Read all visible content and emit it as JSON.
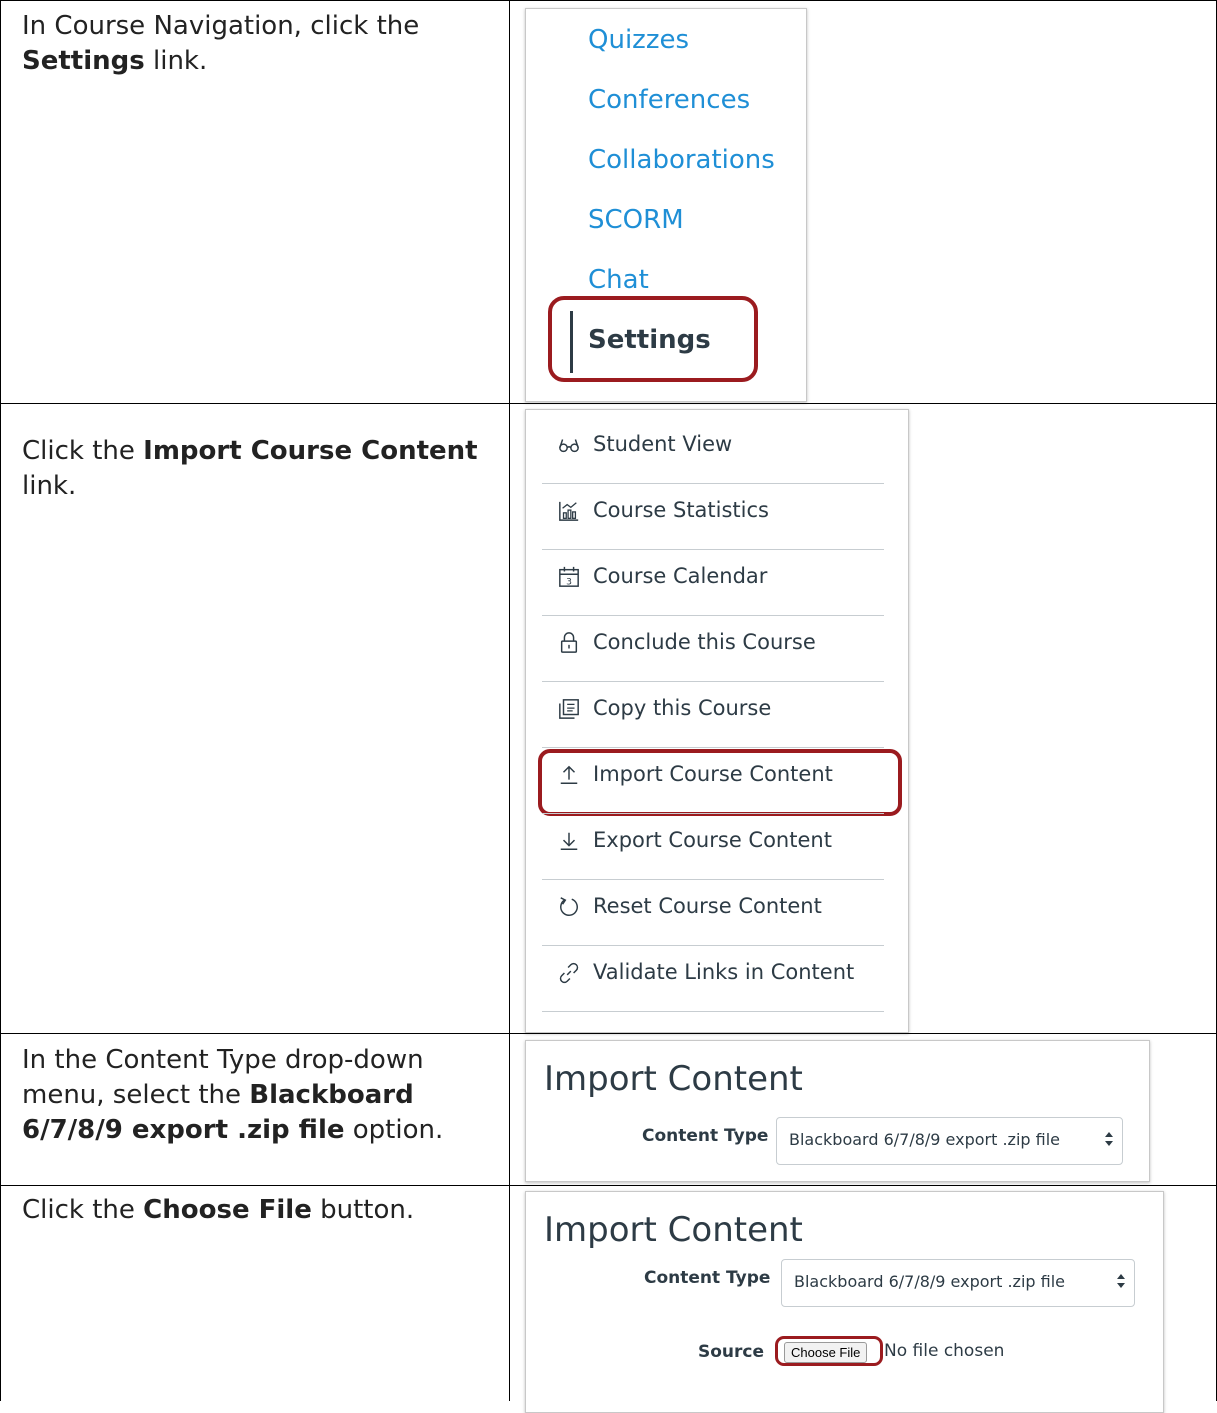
{
  "rows": [
    {
      "parts": [
        "In Course Navigation, click the ",
        "Settings",
        " link."
      ]
    },
    {
      "parts": [
        "Click the ",
        "Import Course Content",
        " link."
      ]
    },
    {
      "parts": [
        "In the Content Type drop-down menu, select the ",
        "Blackboard 6/7/8/9 export .zip file",
        " option."
      ]
    },
    {
      "parts": [
        "Click the ",
        "Choose File",
        " button."
      ]
    }
  ],
  "course_nav": {
    "items": [
      "Quizzes",
      "Conferences",
      "Collaborations",
      "SCORM",
      "Chat"
    ],
    "active": "Settings"
  },
  "sidebar_menu": {
    "items": [
      {
        "label": "Student View",
        "icon": "glasses-icon"
      },
      {
        "label": "Course Statistics",
        "icon": "chart-icon"
      },
      {
        "label": "Course Calendar",
        "icon": "calendar-icon"
      },
      {
        "label": "Conclude this Course",
        "icon": "lock-icon"
      },
      {
        "label": "Copy this Course",
        "icon": "copy-icon"
      },
      {
        "label": "Import Course Content",
        "icon": "upload-icon"
      },
      {
        "label": "Export Course Content",
        "icon": "download-icon"
      },
      {
        "label": "Reset Course Content",
        "icon": "reset-icon"
      },
      {
        "label": "Validate Links in Content",
        "icon": "link-icon"
      }
    ],
    "calendar_day": "3"
  },
  "import_content": {
    "title": "Import Content",
    "content_type_label": "Content Type",
    "content_type_value": "Blackboard 6/7/8/9 export .zip file",
    "source_label": "Source",
    "choose_file": "Choose File",
    "no_file": "No file chosen"
  },
  "colors": {
    "link": "#1f8fd6",
    "highlight": "#9b1b1f",
    "text": "#2d3b45"
  }
}
